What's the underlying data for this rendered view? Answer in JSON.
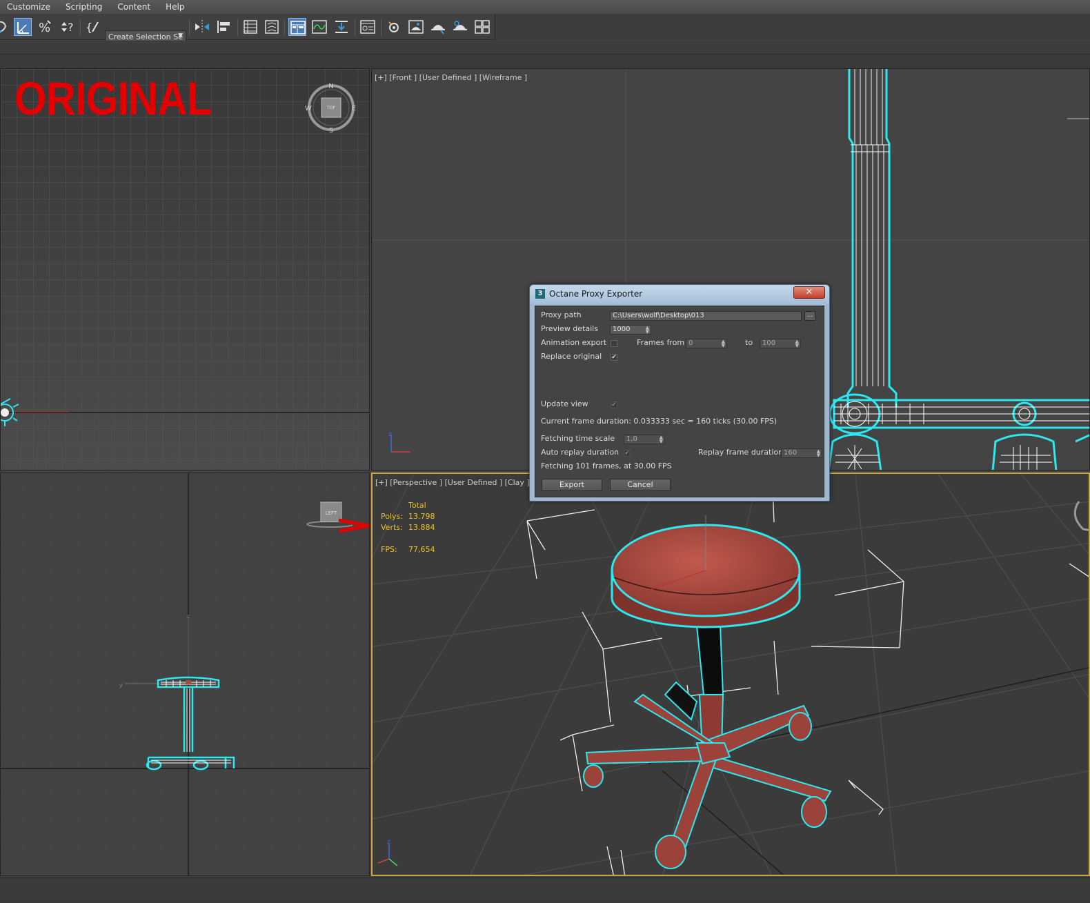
{
  "menu": [
    "Customize",
    "Scripting",
    "Content",
    "Help"
  ],
  "toolbar": {
    "selection_set_label": "Create Selection Se",
    "icons": [
      "snap-toggle-icon",
      "angle-snap-icon",
      "percent-snap-icon",
      "spinner-snap-icon",
      "edit-named-selection-icon",
      "mirror-icon",
      "align-icon",
      "layer-manager-icon",
      "ribbon-icon",
      "scene-explorer-icon",
      "curve-editor-icon",
      "schematic-view-icon",
      "material-editor-icon",
      "render-setup-icon",
      "rendered-frame-window-icon",
      "render-production-icon",
      "render-iterative-icon",
      "viewport-layout-icon"
    ]
  },
  "viewports": {
    "top": {
      "overlay_text": "ORIGINAL",
      "viewcube_letters": {
        "n": "N",
        "s": "S",
        "e": "E",
        "w": "W",
        "face": "TOP"
      }
    },
    "front": {
      "label": "[+] [Front ] [User Defined ] [Wireframe ]"
    },
    "left": {
      "viewcube_face": "LEFT"
    },
    "perspective": {
      "label": "[+] [Perspective ] [User Defined ] [Clay ]",
      "stats": {
        "header": "Total",
        "polys_label": "Polys:",
        "polys": "13.798",
        "verts_label": "Verts:",
        "verts": "13.884",
        "fps_label": "FPS:",
        "fps": "77,654"
      }
    }
  },
  "dialog": {
    "title": "Octane Proxy Exporter",
    "title_icon": "3",
    "close": "✕",
    "proxy_path_label": "Proxy path",
    "proxy_path": "C:\\Users\\wolf\\Desktop\\013",
    "browse": "...",
    "preview_details_label": "Preview details",
    "preview_details": "1000",
    "animation_export_label": "Animation export",
    "animation_export": false,
    "frames_from_label": "Frames from",
    "frames_from": "0",
    "to_label": "to",
    "frames_to": "100",
    "replace_original_label": "Replace original",
    "replace_original": true,
    "update_view_label": "Update view",
    "update_view": true,
    "current_frame_duration": "Current frame duration: 0.033333 sec = 160 ticks (30.00 FPS)",
    "fetching_time_scale_label": "Fetching time scale",
    "fetching_time_scale": "1,0",
    "auto_replay_label": "Auto replay duration",
    "auto_replay": true,
    "replay_frame_duration_label": "Replay frame duration",
    "replay_frame_duration": "160",
    "fetching_info": "Fetching 101 frames, at 30.00 FPS",
    "export_label": "Export",
    "cancel_label": "Cancel"
  },
  "colors": {
    "selection_outline": "#2ee8f0",
    "stool_red": "#a84a40",
    "overlay_red": "#e20000",
    "stats_yellow": "#f0c419",
    "active_viewport_border": "#c8a640"
  }
}
